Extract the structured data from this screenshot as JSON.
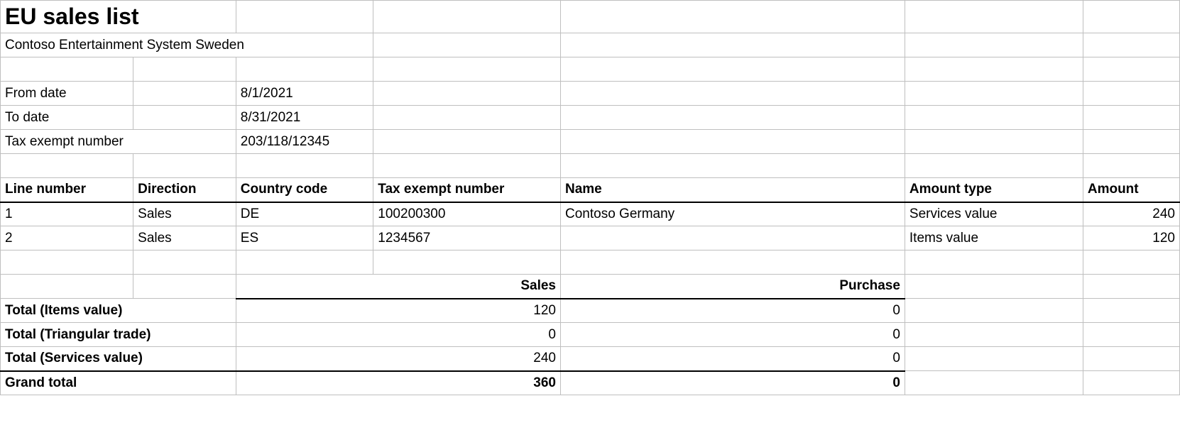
{
  "header": {
    "title": "EU sales list",
    "company": "Contoso Entertainment System Sweden"
  },
  "params": {
    "from_date_label": "From date",
    "from_date_value": "8/1/2021",
    "to_date_label": "To date",
    "to_date_value": "8/31/2021",
    "tax_exempt_label": "Tax exempt number",
    "tax_exempt_value": "203/118/12345"
  },
  "columns": {
    "line_number": "Line number",
    "direction": "Direction",
    "country_code": "Country code",
    "tax_exempt_number": "Tax exempt number",
    "name": "Name",
    "amount_type": "Amount type",
    "amount": "Amount"
  },
  "rows": [
    {
      "line_number": "1",
      "direction": "Sales",
      "country_code": "DE",
      "tax_exempt_number": "100200300",
      "name": "Contoso Germany",
      "amount_type": "Services value",
      "amount": "240"
    },
    {
      "line_number": "2",
      "direction": "Sales",
      "country_code": "ES",
      "tax_exempt_number": "1234567",
      "name": "",
      "amount_type": "Items value",
      "amount": "120"
    }
  ],
  "totals": {
    "sales_header": "Sales",
    "purchase_header": "Purchase",
    "items_label": "Total (Items value)",
    "items_sales": "120",
    "items_purchase": "0",
    "triangular_label": "Total (Triangular trade)",
    "triangular_sales": "0",
    "triangular_purchase": "0",
    "services_label": "Total (Services value)",
    "services_sales": "240",
    "services_purchase": "0",
    "grand_label": "Grand total",
    "grand_sales": "360",
    "grand_purchase": "0"
  }
}
